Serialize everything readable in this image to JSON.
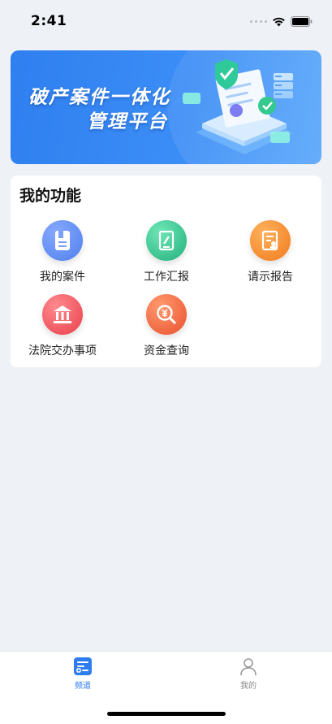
{
  "status_bar": {
    "time": "2:41"
  },
  "banner": {
    "line1": "破产案件一体化",
    "line2": "管理平台"
  },
  "functions": {
    "title": "我的功能",
    "items": [
      {
        "label": "我的案件",
        "icon": "case-file-icon",
        "color": "#5b86f0"
      },
      {
        "label": "工作汇报",
        "icon": "report-pen-icon",
        "color": "#2fc68e"
      },
      {
        "label": "请示报告",
        "icon": "request-stamp-icon",
        "color": "#f58a2a"
      },
      {
        "label": "法院交办事项",
        "icon": "court-building-icon",
        "color": "#f0515a"
      },
      {
        "label": "资金查询",
        "icon": "yuan-search-icon",
        "color": "#f0643c"
      }
    ]
  },
  "tabs": [
    {
      "label": "频道",
      "icon": "channel-icon",
      "active": true,
      "color": "#2e7cf0"
    },
    {
      "label": "我的",
      "icon": "profile-icon",
      "active": false,
      "color": "#888888"
    }
  ]
}
